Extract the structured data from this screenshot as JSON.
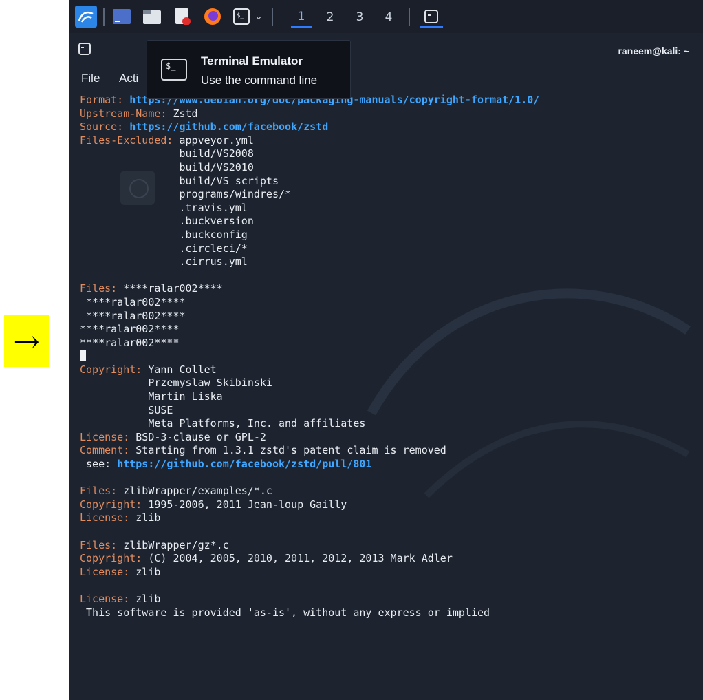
{
  "arrow": "→",
  "taskbar": {
    "workspaces": [
      "1",
      "2",
      "3",
      "4"
    ],
    "active_workspace": "1",
    "icons": [
      "kali-menu-icon",
      "desktop-icon",
      "file-manager-icon",
      "text-editor-icon",
      "firefox-icon",
      "terminal-icon",
      "dropdown-icon",
      "terminal-window-icon"
    ]
  },
  "window": {
    "user": "raneem@kali: ~",
    "menu": [
      "File",
      "Acti"
    ]
  },
  "tooltip": {
    "title": "Terminal Emulator",
    "subtitle": "Use the command line",
    "icon": "$_"
  },
  "terminal": {
    "lines": [
      {
        "key": "Format:",
        "val": " ",
        "url": "https://www.debian.org/doc/packaging-manuals/copyright-format/1.0/"
      },
      {
        "key": "Upstream-Name:",
        "val": " Zstd"
      },
      {
        "key": "Source:",
        "val": " ",
        "url": "https://github.com/facebook/zstd"
      },
      {
        "key": "Files-Excluded:",
        "val": " appveyor.yml"
      },
      {
        "val": "                build/VS2008"
      },
      {
        "val": "                build/VS2010"
      },
      {
        "val": "                build/VS_scripts"
      },
      {
        "val": "                programs/windres/*"
      },
      {
        "val": "                .travis.yml"
      },
      {
        "val": "                .buckversion"
      },
      {
        "val": "                .buckconfig"
      },
      {
        "val": "                .circleci/*"
      },
      {
        "val": "                .cirrus.yml"
      },
      {
        "val": ""
      },
      {
        "key": "Files:",
        "val": " ****ralar002****"
      },
      {
        "val": " ****ralar002****"
      },
      {
        "val": " ****ralar002****"
      },
      {
        "val": "****ralar002****"
      },
      {
        "val": "****ralar002****"
      },
      {
        "cursor": true
      },
      {
        "key": "Copyright:",
        "val": " Yann Collet"
      },
      {
        "val": "           Przemyslaw Skibinski"
      },
      {
        "val": "           Martin Liska"
      },
      {
        "val": "           SUSE"
      },
      {
        "val": "           Meta Platforms, Inc. and affiliates"
      },
      {
        "key": "License:",
        "val": " BSD-3-clause or GPL-2"
      },
      {
        "key": "Comment:",
        "val": " Starting from 1.3.1 zstd's patent claim is removed"
      },
      {
        "val": " see: ",
        "url": "https://github.com/facebook/zstd/pull/801"
      },
      {
        "val": ""
      },
      {
        "key": "Files:",
        "val": " zlibWrapper/examples/*.c"
      },
      {
        "key": "Copyright:",
        "val": " 1995-2006, 2011 Jean-loup Gailly"
      },
      {
        "key": "License:",
        "val": " zlib"
      },
      {
        "val": ""
      },
      {
        "key": "Files:",
        "val": " zlibWrapper/gz*.c"
      },
      {
        "key": "Copyright:",
        "val": " (C) 2004, 2005, 2010, 2011, 2012, 2013 Mark Adler"
      },
      {
        "key": "License:",
        "val": " zlib"
      },
      {
        "val": ""
      },
      {
        "key": "License:",
        "val": " zlib"
      },
      {
        "val": " This software is provided 'as-is', without any express or implied"
      }
    ]
  },
  "colors": {
    "key": "#e08c5f",
    "url": "#3fa7ff",
    "background": "#1d2430",
    "highlight": "#ffff00"
  }
}
